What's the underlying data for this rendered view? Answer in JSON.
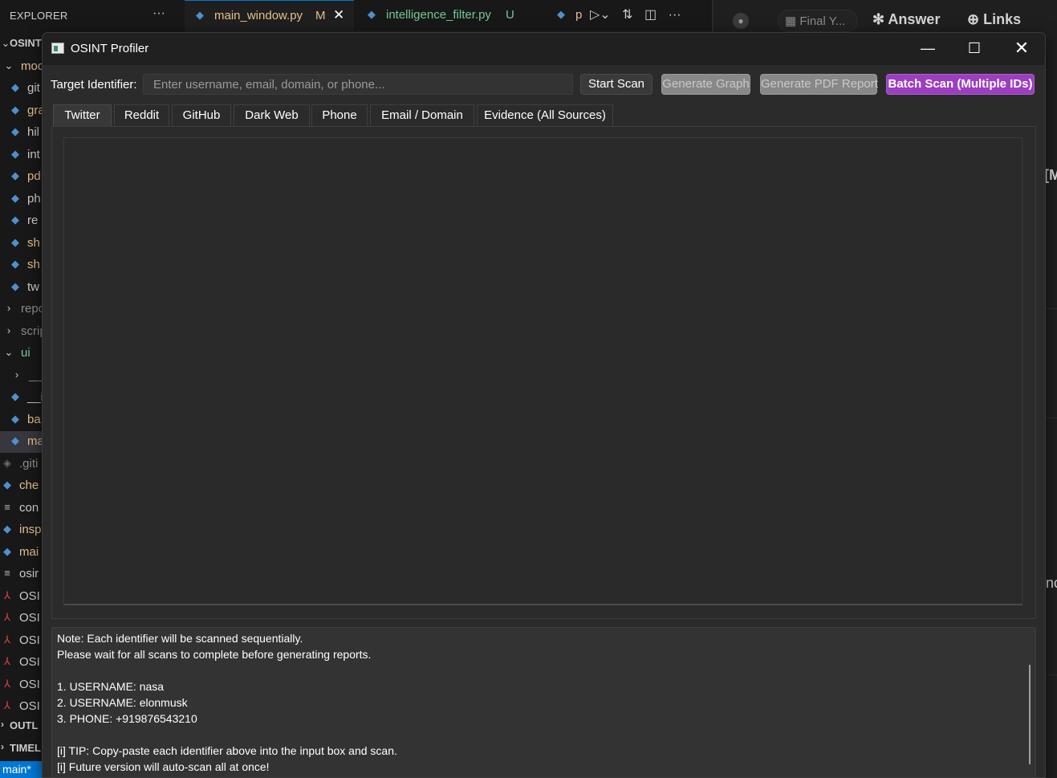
{
  "vscode": {
    "explorer_title": "EXPLORER",
    "explorer_more": "···",
    "tree": [
      {
        "label": "OSINT",
        "icon": "chevron-down-icon",
        "kind": "root"
      },
      {
        "label": "moc",
        "icon": "chevron-down-icon",
        "kind": "folder-open"
      },
      {
        "label": "git",
        "icon": "python-file-icon",
        "kind": "py"
      },
      {
        "label": "gra",
        "icon": "python-file-icon",
        "kind": "py-y"
      },
      {
        "label": "hil",
        "icon": "python-file-icon",
        "kind": "py"
      },
      {
        "label": "int",
        "icon": "python-file-icon",
        "kind": "py"
      },
      {
        "label": "pd",
        "icon": "python-file-icon",
        "kind": "py-y"
      },
      {
        "label": "ph",
        "icon": "python-file-icon",
        "kind": "py"
      },
      {
        "label": "re",
        "icon": "python-file-icon",
        "kind": "py"
      },
      {
        "label": "sh",
        "icon": "python-file-icon",
        "kind": "py-y"
      },
      {
        "label": "sh",
        "icon": "python-file-icon",
        "kind": "py-y"
      },
      {
        "label": "tw",
        "icon": "python-file-icon",
        "kind": "py"
      },
      {
        "label": "repo",
        "icon": "chevron-right-icon",
        "kind": "folder"
      },
      {
        "label": "scrip",
        "icon": "chevron-right-icon",
        "kind": "folder"
      },
      {
        "label": "ui",
        "icon": "chevron-down-icon",
        "kind": "folder-open"
      },
      {
        "label": "__p",
        "icon": "chevron-right-icon",
        "kind": "folder"
      },
      {
        "label": "__i",
        "icon": "python-file-icon",
        "kind": "py"
      },
      {
        "label": "ba",
        "icon": "python-file-icon",
        "kind": "py-y"
      },
      {
        "label": "ma",
        "icon": "python-file-icon",
        "kind": "py-sel"
      },
      {
        "label": ".giti",
        "icon": "git-icon",
        "kind": "git"
      },
      {
        "label": "che",
        "icon": "python-file-icon",
        "kind": "py-y"
      },
      {
        "label": "con",
        "icon": "text-file-icon",
        "kind": "txt"
      },
      {
        "label": "insp",
        "icon": "python-file-icon",
        "kind": "py-y"
      },
      {
        "label": "mai",
        "icon": "python-file-icon",
        "kind": "py-y"
      },
      {
        "label": "osir",
        "icon": "text-file-icon",
        "kind": "txt"
      },
      {
        "label": "OSI",
        "icon": "pdf-file-icon",
        "kind": "pdf"
      },
      {
        "label": "OSI",
        "icon": "pdf-file-icon",
        "kind": "pdf"
      },
      {
        "label": "OSI",
        "icon": "pdf-file-icon",
        "kind": "pdf"
      },
      {
        "label": "OSI",
        "icon": "pdf-file-icon",
        "kind": "pdf"
      },
      {
        "label": "OSI",
        "icon": "pdf-file-icon",
        "kind": "pdf"
      },
      {
        "label": "OSI",
        "icon": "pdf-file-icon",
        "kind": "pdf"
      }
    ],
    "outline_label": "OUTL",
    "timeline_label": "TIMEL",
    "status_branch": "main*",
    "editor_tabs": [
      {
        "label": "main_window.py",
        "badge": "M"
      },
      {
        "label": "intelligence_filter.py",
        "badge": "U"
      },
      {
        "label": "p",
        "badge": ""
      }
    ],
    "right_pane": {
      "chip_label": "Final Y...",
      "answer_label": "Answer",
      "links_label": "Links",
      "fragment_1": "[M",
      "fragment_2": "nc"
    }
  },
  "window": {
    "title": "OSINT Profiler",
    "controls": {
      "minimize": "—",
      "maximize": "☐",
      "close": "✕"
    }
  },
  "toolbar": {
    "target_label": "Target Identifier:",
    "target_placeholder": "Enter username, email, domain, or phone...",
    "target_value": "",
    "start_scan": "Start Scan",
    "generate_graph": "Generate Graph",
    "generate_pdf": "Generate PDF Report",
    "batch_scan": "Batch Scan (Multiple IDs)"
  },
  "tabs": [
    {
      "label": "Twitter",
      "active": true
    },
    {
      "label": "Reddit",
      "active": false
    },
    {
      "label": "GitHub",
      "active": false
    },
    {
      "label": "Dark Web",
      "active": false
    },
    {
      "label": "Phone",
      "active": false
    },
    {
      "label": "Email / Domain",
      "active": false
    },
    {
      "label": "Evidence (All Sources)",
      "active": false
    }
  ],
  "log": {
    "lines": [
      "Note: Each identifier will be scanned sequentially.",
      "Please wait for all scans to complete before generating reports.",
      "",
      "1. USERNAME: nasa",
      "2. USERNAME: elonmusk",
      "3. PHONE: +919876543210",
      "",
      "[i] TIP: Copy-paste each identifier above into the input box and scan.",
      "[i] Future version will auto-scan all at once!"
    ]
  },
  "colors": {
    "batch_button": "#9b3fbf",
    "disabled_button": "#888888",
    "vscode_accent": "#0078d4",
    "modified_tab": "#e2c08d",
    "untracked_tab": "#73c991"
  }
}
